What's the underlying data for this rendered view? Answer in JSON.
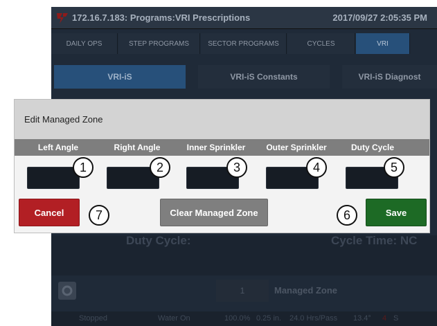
{
  "app": {
    "title": "172.16.7.183: Programs:VRI Prescriptions",
    "datetime": "2017/09/27 2:05:35 PM",
    "logo_icon": "company-logo-icon"
  },
  "tabs": [
    {
      "label": "DAILY OPS"
    },
    {
      "label": "STEP PROGRAMS"
    },
    {
      "label": "SECTOR PROGRAMS"
    },
    {
      "label": "CYCLES"
    },
    {
      "label": "VRI"
    }
  ],
  "subtabs": [
    {
      "label": "VRI-iS"
    },
    {
      "label": "VRI-iS Constants"
    },
    {
      "label": "VRI-iS Diagnost"
    }
  ],
  "background": {
    "duty_cycle_label": "Duty Cycle:",
    "cycle_time_label": "Cycle Time: NC",
    "managed_zone_number": "1",
    "managed_zone_label": "Managed Zone",
    "settings_icon": "gear-icon"
  },
  "status": {
    "state": "Stopped",
    "water": "Water On",
    "percent": "100.0%",
    "depth": "0.25 in.",
    "hours": "24.0 Hrs/Pass",
    "angle": "13.4°",
    "warn": "4",
    "extra": "S"
  },
  "dialog": {
    "title": "Edit Managed Zone",
    "columns": [
      "Left Angle",
      "Right Angle",
      "Inner Sprinkler",
      "Outer Sprinkler",
      "Duty Cycle"
    ],
    "fields": [
      "",
      "",
      "",
      "",
      ""
    ],
    "badges": [
      "1",
      "2",
      "3",
      "4",
      "5",
      "6",
      "7"
    ],
    "buttons": {
      "cancel": "Cancel",
      "clear": "Clear Managed Zone",
      "save": "Save"
    }
  },
  "colors": {
    "cancel": "#b21f24",
    "save": "#1d6a25",
    "clear": "#7f7f7f",
    "active_tab": "#27507a"
  }
}
